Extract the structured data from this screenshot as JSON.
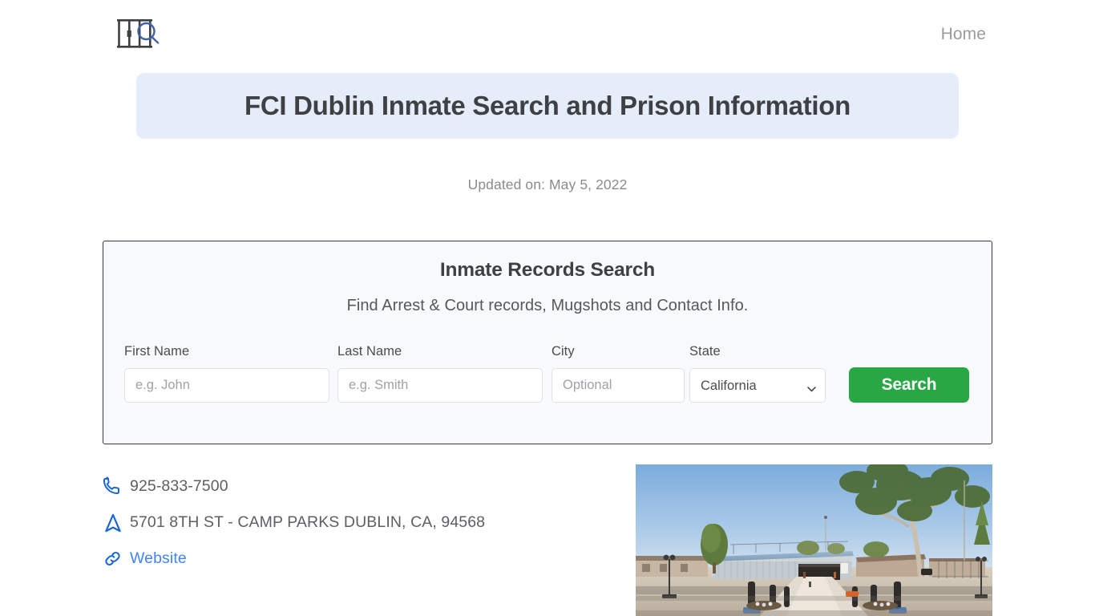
{
  "header": {
    "logo_alt": "jail-bars-with-magnifier-logo",
    "nav": [
      {
        "label": "Home",
        "name": "nav-link-home"
      }
    ]
  },
  "page": {
    "title": "FCI Dublin Inmate Search and Prison Information",
    "updated": "Updated on: May 5, 2022",
    "banner_color": "#e5ecfa"
  },
  "search_card": {
    "title": "Inmate Records Search",
    "subtitle": "Find Arrest & Court records, Mugshots and Contact Info.",
    "fields": {
      "first_name": {
        "label": "First Name",
        "placeholder": "e.g. John",
        "value": ""
      },
      "last_name": {
        "label": "Last Name",
        "placeholder": "e.g. Smith",
        "value": ""
      },
      "city": {
        "label": "City",
        "placeholder": "Optional",
        "value": ""
      },
      "state": {
        "label": "State",
        "selected": "California"
      }
    },
    "submit_label": "Search",
    "submit_color": "#28a745"
  },
  "contact": {
    "phone": {
      "icon": "phone-icon",
      "text": "925-833-7500"
    },
    "address": {
      "icon": "navigation-arrow-icon",
      "text": "5701 8TH ST - CAMP PARKS DUBLIN, CA, 94568"
    },
    "website": {
      "icon": "link-icon",
      "label": "Website",
      "color": "#4285f4"
    }
  },
  "photo": {
    "alt": "FCI Dublin facility entrance with blue roofed building, trees and bollard lined walkway"
  }
}
